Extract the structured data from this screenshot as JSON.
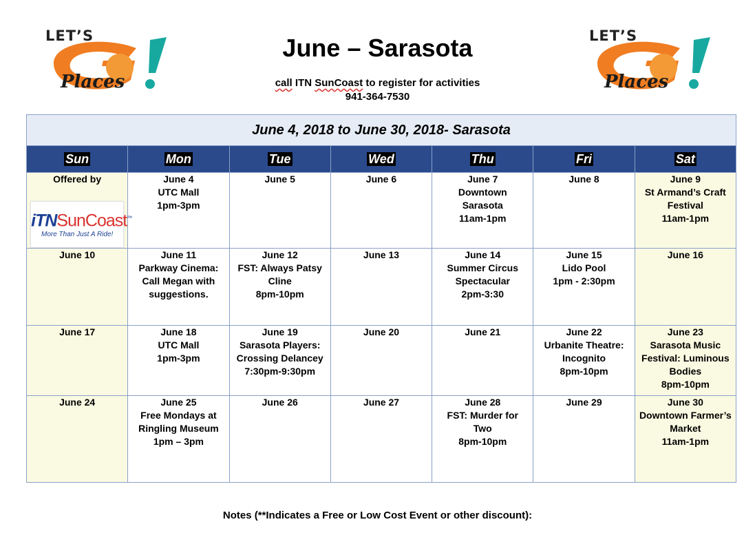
{
  "header": {
    "title": "June – Sarasota",
    "subtitle_call": "call",
    "subtitle_itn": "ITN",
    "subtitle_suncoast": "SunCoast",
    "subtitle_rest": "to register for activities",
    "phone": "941-364-7530",
    "logo": {
      "lets": "LET’S",
      "go": "GO",
      "places": "Places"
    }
  },
  "calendar": {
    "range": "June 4, 2018 to June 30, 2018- Sarasota",
    "days": [
      "Sun",
      "Mon",
      "Tue",
      "Wed",
      "Thu",
      "Fri",
      "Sat"
    ],
    "weeks": [
      [
        {
          "lines": [
            "Offered by"
          ]
        },
        {
          "lines": [
            "June 4",
            "UTC Mall",
            "1pm-3pm"
          ]
        },
        {
          "lines": [
            "June 5"
          ]
        },
        {
          "lines": [
            "June 6"
          ]
        },
        {
          "lines": [
            "June 7",
            "Downtown",
            "Sarasota",
            "11am-1pm"
          ]
        },
        {
          "lines": [
            "June 8"
          ]
        },
        {
          "lines": [
            "June 9",
            "St Armand’s Craft",
            "Festival",
            "11am-1pm"
          ]
        }
      ],
      [
        {
          "lines": [
            "June 10"
          ]
        },
        {
          "lines": [
            "June 11",
            "Parkway Cinema:",
            "Call Megan with",
            "suggestions."
          ]
        },
        {
          "lines": [
            "June 12",
            "FST: Always Patsy",
            "Cline",
            "8pm-10pm"
          ]
        },
        {
          "lines": [
            "June 13"
          ]
        },
        {
          "lines": [
            "June 14",
            "Summer Circus",
            "Spectacular",
            "2pm-3:30"
          ]
        },
        {
          "lines": [
            "June 15",
            "Lido Pool",
            "1pm - 2:30pm"
          ]
        },
        {
          "lines": [
            "June 16"
          ]
        }
      ],
      [
        {
          "lines": [
            "June 17"
          ]
        },
        {
          "lines": [
            "June 18",
            "UTC Mall",
            "1pm-3pm"
          ]
        },
        {
          "lines": [
            "June 19",
            "Sarasota Players:",
            "Crossing Delancey",
            "7:30pm-9:30pm"
          ]
        },
        {
          "lines": [
            "June 20"
          ]
        },
        {
          "lines": [
            "June 21"
          ]
        },
        {
          "lines": [
            "June 22",
            "Urbanite Theatre:",
            "Incognito",
            "8pm-10pm"
          ]
        },
        {
          "lines": [
            "June 23",
            "Sarasota Music",
            "Festival: Luminous",
            "Bodies",
            "8pm-10pm"
          ]
        }
      ],
      [
        {
          "lines": [
            "June 24"
          ]
        },
        {
          "lines": [
            "June 25",
            "Free Mondays at",
            "Ringling Museum",
            "1pm – 3pm"
          ]
        },
        {
          "lines": [
            "June 26"
          ]
        },
        {
          "lines": [
            "June 27"
          ]
        },
        {
          "lines": [
            "June 28",
            "FST: Murder for",
            "Two",
            "8pm-10pm"
          ]
        },
        {
          "lines": [
            "June 29"
          ]
        },
        {
          "lines": [
            "June 30",
            "Downtown Farmer’s",
            "Market",
            "11am-1pm"
          ]
        }
      ]
    ]
  },
  "sponsor": {
    "itn": "iTN",
    "suncoast": "SunCoast",
    "tm": "™",
    "tagline": "More Than Just A Ride!"
  },
  "notes": "Notes (**Indicates a Free or Low Cost Event or other discount):",
  "colors": {
    "header_bar": "#2a4a8c",
    "range_bar": "#e6ecf6",
    "weekend": "#fafae2",
    "logo_orange": "#f07d22",
    "logo_teal": "#17a9a0"
  }
}
